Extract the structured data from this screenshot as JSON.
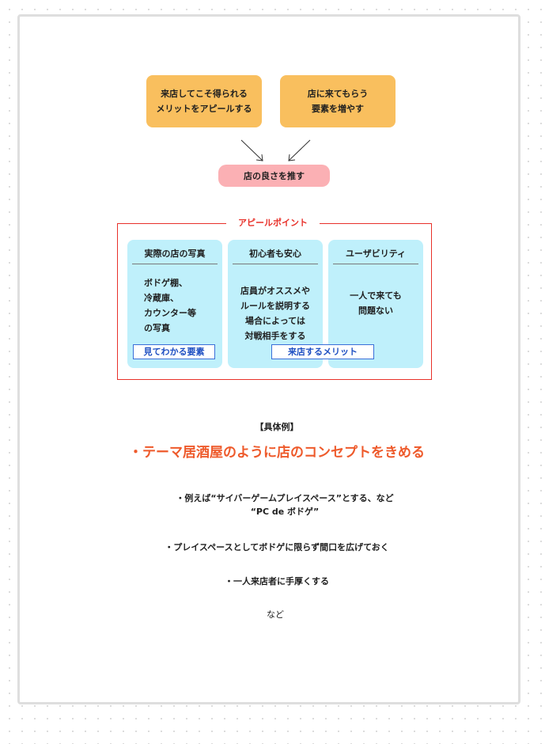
{
  "diagram": {
    "top_left": "来店してこそ得られる\nメリットをアピールする",
    "top_right": "店に来てもらう\n要素を増やす",
    "middle": "店の良さを推す",
    "appeal": {
      "title": "アピールポイント",
      "columns": [
        {
          "head": "実際の店の写真",
          "body": "ボドゲ棚、\n冷蔵庫、\nカウンター等\nの写真"
        },
        {
          "head": "初心者も安心",
          "body": "店員がオススメや\nルールを説明する\n場合によっては\n対戦相手をする"
        },
        {
          "head": "ユーザビリティ",
          "body": "一人で来ても\n問題ない"
        }
      ],
      "tag_visual": "見てわかる要素",
      "tag_merit": "来店するメリット"
    }
  },
  "examples": {
    "heading": "【具体例】",
    "headline": "・テーマ居酒屋のように店のコンセプトをきめる",
    "item1": "・例えば“サイバーゲームプレイスペース”とする、など\n“PC de ボドゲ”",
    "item2": "・プレイスペースとしてボドゲに限らず間口を広げておく",
    "item3": "・一人来店者に手厚くする",
    "etc": "など"
  },
  "colors": {
    "orange": "#f9bf5e",
    "pink": "#fbb0b4",
    "cyan": "#bff0fb",
    "red": "#e8312a",
    "blue": "#1e4fc2",
    "headline": "#ee5a2b"
  }
}
